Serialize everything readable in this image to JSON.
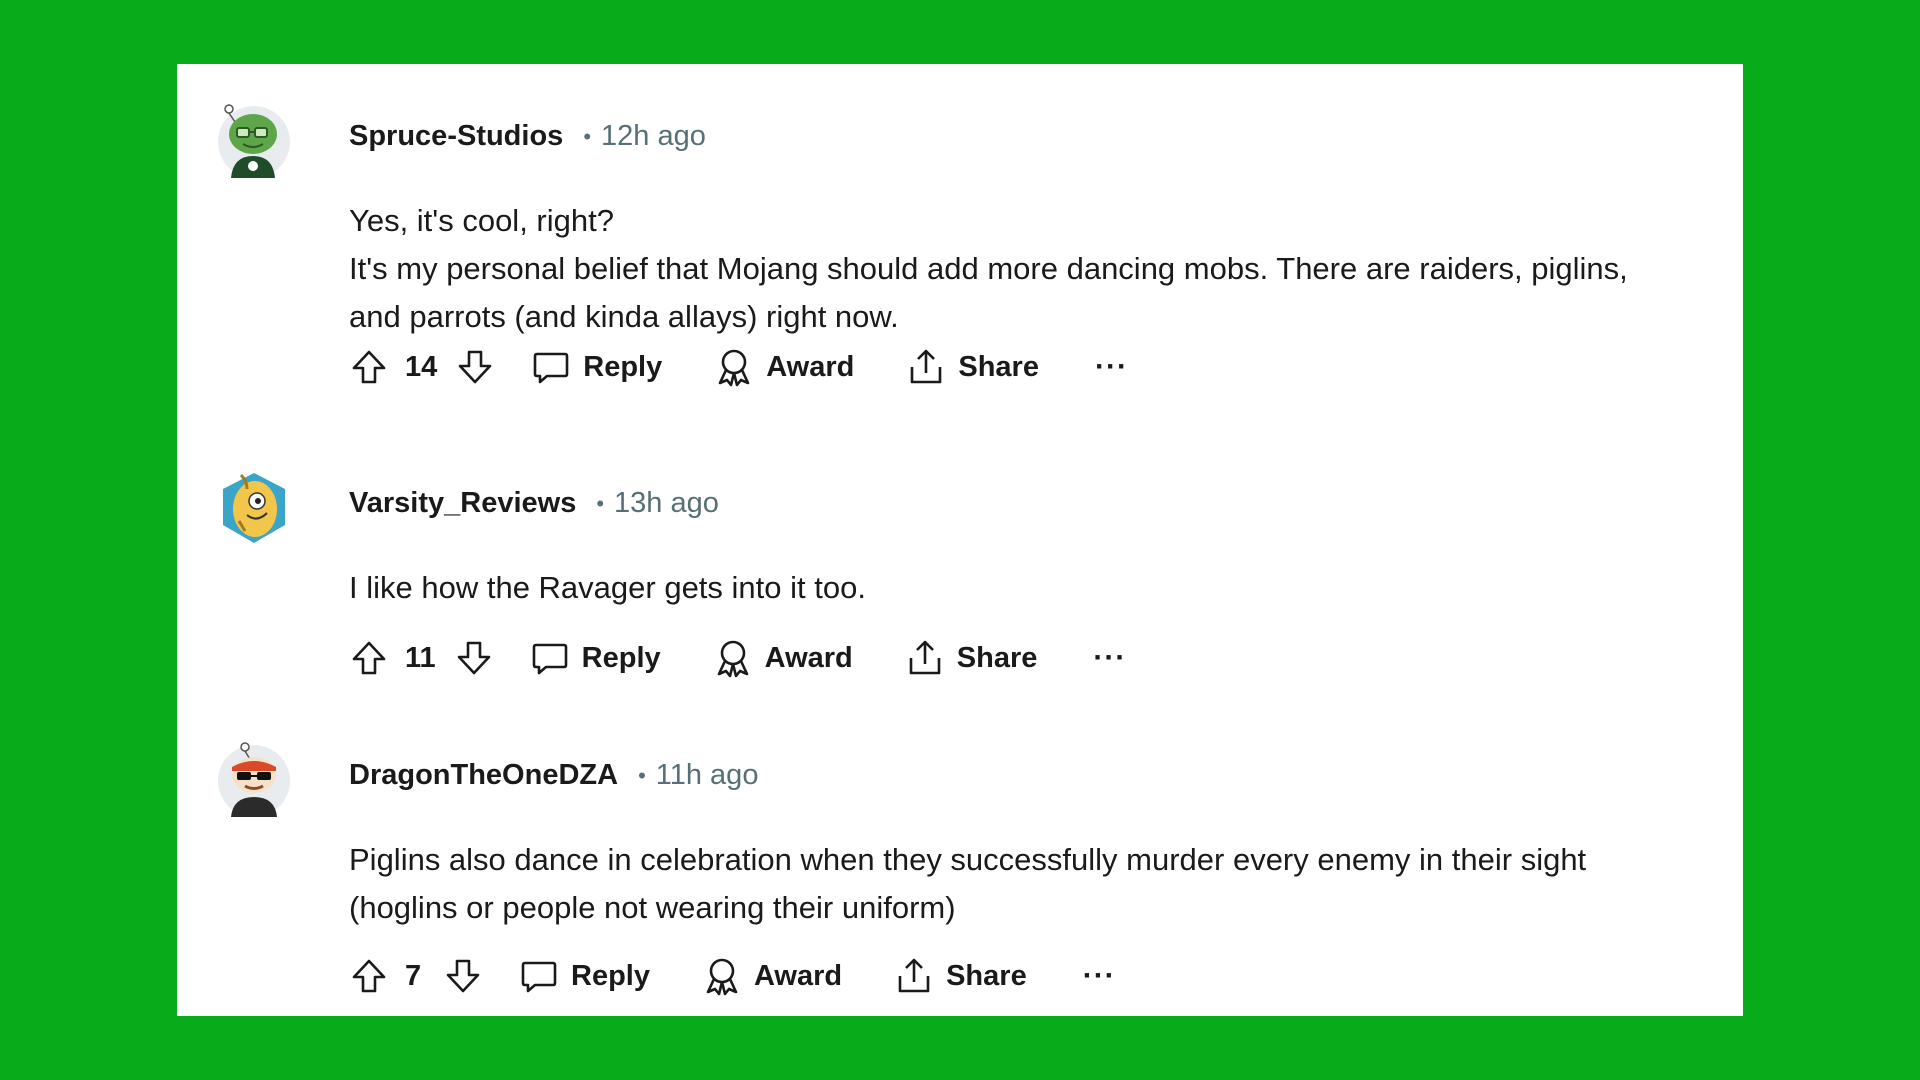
{
  "comments": [
    {
      "author": "Spruce-Studios",
      "separator": "•",
      "time": "12h ago",
      "avatar_icon": "green-snoo-avatar-icon",
      "body": [
        "Yes, it's cool, right?",
        "It's my personal belief that Mojang should add more dancing mobs. There are raiders, piglins, and parrots (and kinda allays) right now."
      ],
      "score": "14",
      "reply_label": "Reply",
      "award_label": "Award",
      "share_label": "Share",
      "more_label": "···"
    },
    {
      "author": "Varsity_Reviews",
      "separator": "•",
      "time": "13h ago",
      "avatar_icon": "banana-mascot-avatar-icon",
      "body": [
        "I like how the Ravager gets into it too."
      ],
      "score": "11",
      "reply_label": "Reply",
      "award_label": "Award",
      "share_label": "Share",
      "more_label": "···"
    },
    {
      "author": "DragonTheOneDZA",
      "separator": "•",
      "time": "11h ago",
      "avatar_icon": "snoo-sunglasses-avatar-icon",
      "body": [
        "Piglins also dance in celebration when they successfully murder every enemy in their sight (hoglins or people not wearing their uniform)"
      ],
      "score": "7",
      "reply_label": "Reply",
      "award_label": "Award",
      "share_label": "Share",
      "more_label": "···"
    }
  ],
  "colors": {
    "background": "#08ac1a",
    "card": "#ffffff",
    "text": "#1a1a1b",
    "meta": "#576f76"
  }
}
